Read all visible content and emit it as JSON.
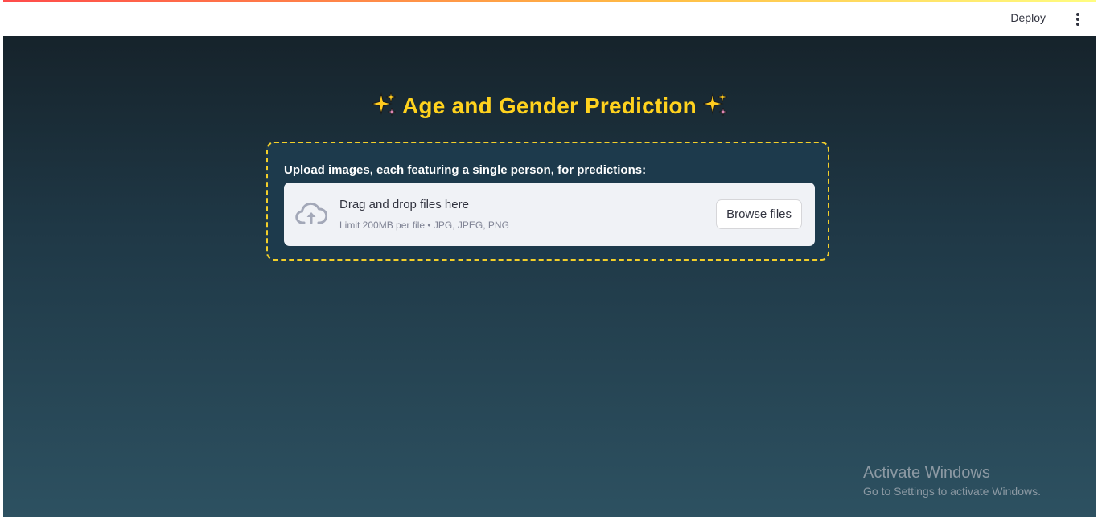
{
  "header": {
    "deploy_label": "Deploy",
    "menu_icon": "kebab-vertical-icon"
  },
  "main": {
    "title": "Age and Gender Prediction",
    "title_icon": "sparkles-icon",
    "title_color": "#ffd21e"
  },
  "uploader": {
    "label": "Upload images, each featuring a single person, for predictions:",
    "drop_text": "Drag and drop files here",
    "limit_text": "Limit 200MB per file • JPG, JPEG, PNG",
    "browse_label": "Browse files",
    "icon": "cloud-upload-icon",
    "border_color": "#f3cf2a"
  },
  "watermark": {
    "title": "Activate Windows",
    "subtitle": "Go to Settings to activate Windows."
  }
}
